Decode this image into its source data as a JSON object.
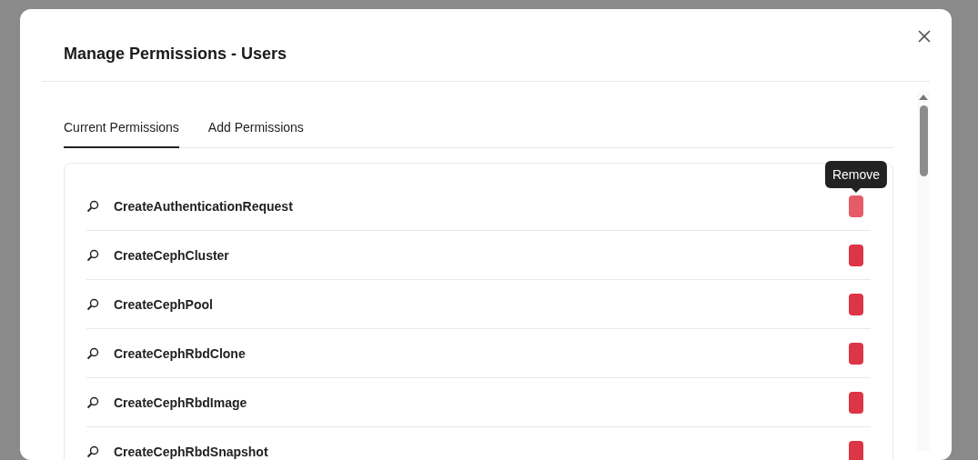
{
  "dialog": {
    "title": "Manage Permissions - Users"
  },
  "tabs": [
    {
      "label": "Current Permissions",
      "selected": true
    },
    {
      "label": "Add Permissions",
      "selected": false
    }
  ],
  "permissions": [
    {
      "name": "CreateAuthenticationRequest",
      "hovered": true
    },
    {
      "name": "CreateCephCluster",
      "hovered": false
    },
    {
      "name": "CreateCephPool",
      "hovered": false
    },
    {
      "name": "CreateCephRbdClone",
      "hovered": false
    },
    {
      "name": "CreateCephRbdImage",
      "hovered": false
    },
    {
      "name": "CreateCephRbdSnapshot",
      "hovered": false
    }
  ],
  "tooltip": {
    "text": "Remove"
  }
}
